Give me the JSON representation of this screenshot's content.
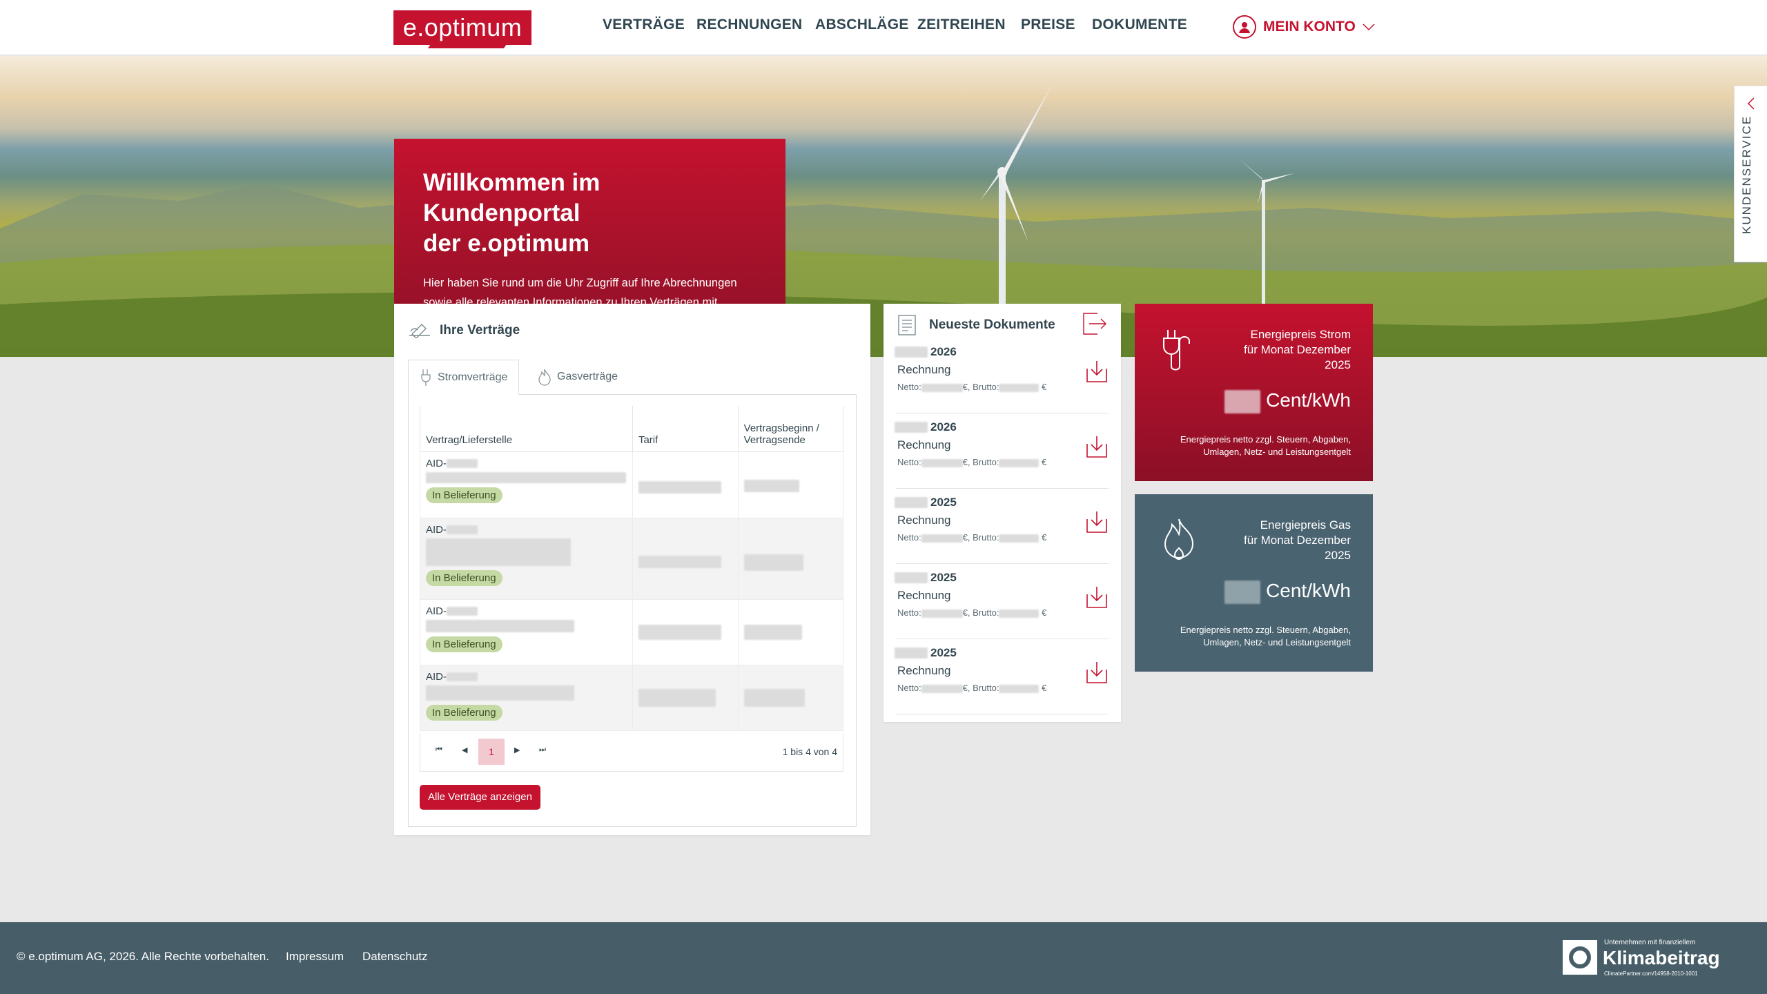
{
  "header": {
    "logo": "e.optimum",
    "nav": [
      "VERTRÄGE",
      "RECHNUNGEN",
      "ABSCHLÄGE",
      "ZEITREIHEN",
      "PREISE",
      "DOKUMENTE"
    ],
    "account": "MEIN KONTO"
  },
  "sidetab": "KUNDENSERVICE",
  "welcome": {
    "title_line1": "Willkommen im Kundenportal",
    "title_line2": "der e.optimum",
    "text": "Hier haben Sie rund um die Uhr Zugriff auf Ihre Abrechnungen sowie alle relevanten Informationen zu Ihren Verträgen mit e.optimum. Bitte navigieren Sie je nach Anliegen über die Themen in der Hauptnavigation."
  },
  "contracts": {
    "title": "Ihre Verträge",
    "tabs": [
      "Stromverträge",
      "Gasverträge"
    ],
    "columns": [
      "Vertrag/Lieferstelle",
      "Tarif",
      "Vertragsbeginn / Vertragsende"
    ],
    "rows": [
      {
        "id": "AID-",
        "status": "In Belieferung"
      },
      {
        "id": "AID-",
        "status": "In Belieferung"
      },
      {
        "id": "AID-",
        "status": "In Belieferung"
      },
      {
        "id": "AID-",
        "status": "In Belieferung"
      }
    ],
    "pager": {
      "page": "1",
      "summary": "1 bis 4 von 4"
    },
    "show_all": "Alle Verträge anzeigen"
  },
  "documents": {
    "title": "Neueste Dokumente",
    "items": [
      {
        "year": "2026",
        "type": "Rechnung",
        "netto": "Netto:",
        "brutto": "€, Brutto:",
        "euro": "€"
      },
      {
        "year": "2026",
        "type": "Rechnung",
        "netto": "Netto:",
        "brutto": "€, Brutto:",
        "euro": "€"
      },
      {
        "year": "2025",
        "type": "Rechnung",
        "netto": "Netto:",
        "brutto": "€, Brutto:",
        "euro": "€"
      },
      {
        "year": "2025",
        "type": "Rechnung",
        "netto": "Netto:",
        "brutto": "€, Brutto:",
        "euro": "€"
      },
      {
        "year": "2025",
        "type": "Rechnung",
        "netto": "Netto:",
        "brutto": "€, Brutto:",
        "euro": "€"
      }
    ]
  },
  "prices": {
    "strom": {
      "title_line1": "Energiepreis Strom",
      "title_line2": "für Monat Dezember",
      "title_line3": "2025",
      "unit": "Cent/kWh",
      "note_line1": "Energiepreis netto zzgl. Steuern, Abgaben,",
      "note_line2": "Umlagen, Netz- und Leistungsentgelt"
    },
    "gas": {
      "title_line1": "Energiepreis Gas",
      "title_line2": "für Monat Dezember",
      "title_line3": "2025",
      "unit": "Cent/kWh",
      "note_line1": "Energiepreis netto zzgl. Steuern, Abgaben,",
      "note_line2": "Umlagen, Netz- und Leistungsentgelt"
    }
  },
  "footer": {
    "copyright": "© e.optimum AG, 2026. Alle Rechte vorbehalten.",
    "links": [
      "Impressum",
      "Datenschutz"
    ],
    "badge_small": "Unternehmen mit finanziellem",
    "badge_big": "Klimabeitrag",
    "badge_url": "ClimatePartner.com/14958-2010-1001"
  },
  "colors": {
    "brand_red": "#c4122f",
    "slate": "#475e68",
    "status_green": "#c5d9a5"
  }
}
